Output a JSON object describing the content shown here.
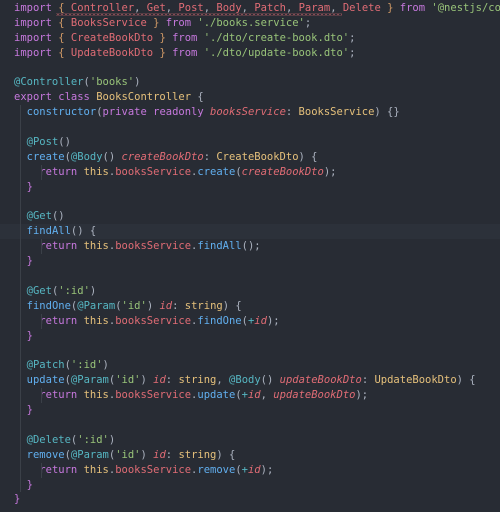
{
  "editor": {
    "background_color": "#282c34",
    "active_line_color": "#2c313a",
    "active_line_index": 11,
    "error_squiggle_color": "#e06c75",
    "colors": {
      "keyword": "#c678dd",
      "identifier": "#e06c75",
      "string": "#98c379",
      "decorator": "#56b6c2",
      "class": "#e5c07b",
      "function": "#61afef",
      "punctuation": "#abb2bf",
      "brace": "#d19a66"
    }
  },
  "code": {
    "language": "typescript",
    "lines": [
      "import { Controller, Get, Post, Body, Patch, Param, Delete } from '@nestjs/common';",
      "import { BooksService } from './books.service';",
      "import { CreateBookDto } from './dto/create-book.dto';",
      "import { UpdateBookDto } from './dto/update-book.dto';",
      "",
      "@Controller('books')",
      "export class BooksController {",
      "  constructor(private readonly booksService: BooksService) {}",
      "",
      "  @Post()",
      "  create(@Body() createBookDto: CreateBookDto) {",
      "    return this.booksService.create(createBookDto);",
      "  }",
      "",
      "  @Get()",
      "  findAll() {",
      "    return this.booksService.findAll();",
      "  }",
      "",
      "  @Get(':id')",
      "  findOne(@Param('id') id: string) {",
      "    return this.booksService.findOne(+id);",
      "  }",
      "",
      "  @Patch(':id')",
      "  update(@Param('id') id: string, @Body() updateBookDto: UpdateBookDto) {",
      "    return this.booksService.update(+id, updateBookDto);",
      "  }",
      "",
      "  @Delete(':id')",
      "  remove(@Param('id') id: string) {",
      "    return this.booksService.remove(+id);",
      "  }",
      "}"
    ],
    "tokens": {
      "import_keyword": "import",
      "from_keyword": "from",
      "export_keyword": "export",
      "class_keyword": "class",
      "return_keyword": "return",
      "private_keyword": "private",
      "readonly_keyword": "readonly",
      "this_keyword": "this",
      "string_type": "string",
      "class_name": "BooksController",
      "service_name": "BooksService",
      "create_dto": "CreateBookDto",
      "update_dto": "UpdateBookDto",
      "module_nestjs_common": "'@nestjs/common'",
      "module_books_service": "'./books.service'",
      "module_create_dto": "'./dto/create-book.dto'",
      "module_update_dto": "'./dto/update-book.dto'",
      "controller_path": "'books'",
      "id_path": "':id'",
      "id_param": "'id'",
      "decorators": [
        "@Controller",
        "@Post",
        "@Get",
        "@Patch",
        "@Delete",
        "@Body",
        "@Param"
      ],
      "methods": [
        "constructor",
        "create",
        "findAll",
        "findOne",
        "update",
        "remove"
      ],
      "imported_symbols": [
        "Controller",
        "Get",
        "Post",
        "Body",
        "Patch",
        "Param",
        "Delete"
      ]
    }
  }
}
